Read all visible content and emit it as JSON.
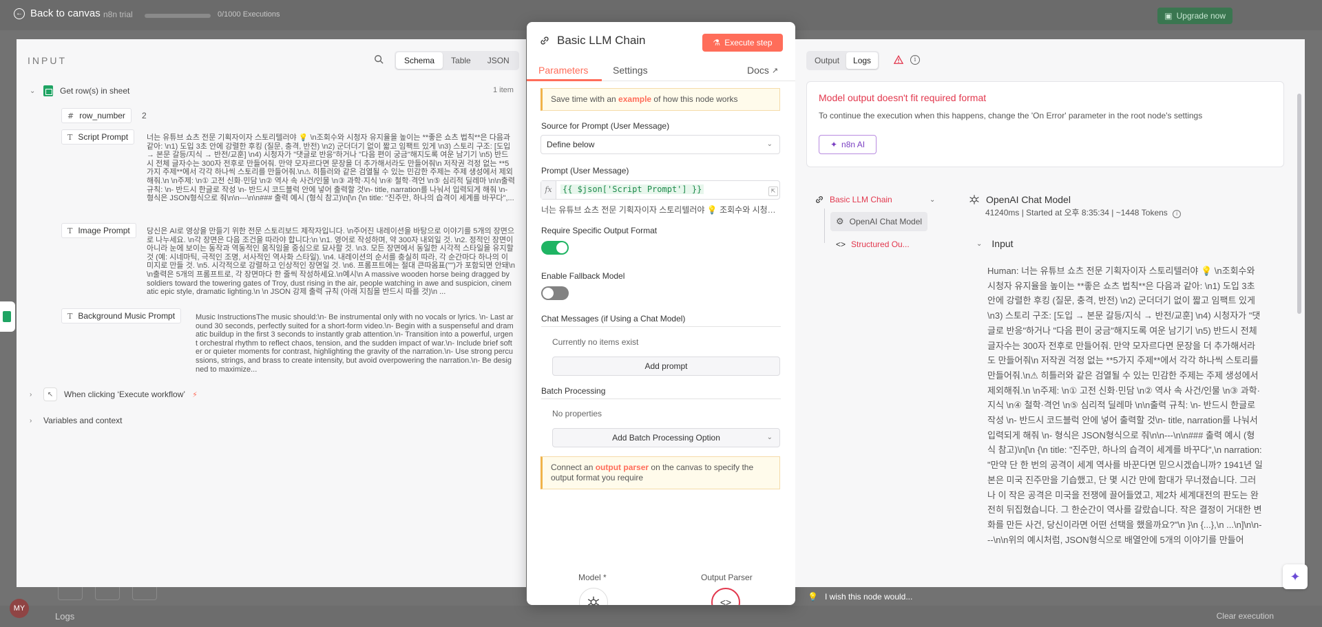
{
  "topbar": {
    "back_label": "Back to canvas",
    "trial_label": "n8n trial",
    "executions": "0/1000 Executions",
    "upgrade_label": "Upgrade now"
  },
  "bottombar": {
    "logs_label": "Logs",
    "clear_label": "Clear execution",
    "avatar_initials": "MY"
  },
  "input_panel": {
    "title": "INPUT",
    "view_tabs": [
      "Schema",
      "Table",
      "JSON"
    ],
    "active_view": "Schema",
    "node_name": "Get row(s) in sheet",
    "item_count": "1 item",
    "fields": {
      "row_number": {
        "name": "row_number",
        "value": "2"
      },
      "script_prompt": {
        "name": "Script Prompt",
        "value": "너는 유튜브 쇼츠 전문 기획자이자 스토리텔러야 💡 \\n조회수와 시청자 유지율을 높이는 **좋은 쇼츠 법칙**은 다음과 같아: \\n1) 도입 3초 안에 강렬한 후킹 (질문, 충격, 반전) \\n2) 군더더기 없이 짧고 임팩트 있게 \\n3) 스토리 구조: [도입 → 본문 갈등/지식 → 반전/교훈] \\n4) 시청자가 \"댓글로 반응\"하거나 \"다음 편이 궁금\"해지도록 여운 남기기 \\n5) 반드시 전체 글자수는 300자 전후로 만들어줘. 만약 모자르다면 문장을 더 추가해서라도 만들어줘\\n 저작권 걱정 없는 **5가지 주제**에서 각각 하나씩 스토리를 만들어줘.\\n⚠ 히틀러와 같은 검열될 수 있는 민감한 주제는 주제 생성에서 제외해줘.\\n \\n주제: \\n① 고전 신화·민담 \\n② 역사 속 사건/인물 \\n③ 과학·지식 \\n④ 철학·격언 \\n⑤ 심리적 딜레마 \\n\\n출력 규칙: \\n- 반드시 한글로 작성 \\n- 반드시 코드블럭 안에 넣어 출력할 것\\n- title, narration를 나눠서 입력되게 해줘 \\n- 형식은 JSON형식으로 줘\\n\\n---\\n\\n### 출력 예시 (형식 참고)\\n[\\n {\\n title: \"진주만, 하나의 습격이 세계를 바꾸다\",..."
      },
      "image_prompt": {
        "name": "Image Prompt",
        "value": "당신은 AI로 영상을 만들기 위한 전문 스토리보드 제작자입니다. \\n주어진 내레이션을 바탕으로 이야기를 5개의 장면으로 나누세요. \\n각 장면은 다음 조건을 따라야 합니다:\\n \\n1. 영어로 작성하며, 약 300자 내외일 것. \\n2. 정적인 장면이 아니라 눈에 보이는 동작과 역동적인 움직임을 중심으로 묘사할 것. \\n3. 모든 장면에서 동일한 시각적 스타일을 유지할 것 (예: 시네마틱, 극적인 조명, 서사적인 역사화 스타일). \\n4. 내레이션의 순서를 충실히 따라, 각 순간마다 하나의 이미지로 만들 것. \\n5. 시각적으로 강렬하고 인상적인 장면일 것. \\n6. 프롬프트에는 절대 큰따옴표(\"\")가 포함되면 안돼\\n \\n출력은 5개의 프롬프트로, 각 장면마다 한 줄씩 작성하세요.\\n예시\\n A massive wooden horse being dragged by soldiers toward the towering gates of Troy, dust rising in the air, people watching in awe and suspicion, cinematic epic style, dramatic lighting.\\n \\n JSON 강제 출력 규칙 (아래 지침을 반드시 따를 것)\\n ..."
      },
      "bgm_prompt": {
        "name": "Background Music Prompt",
        "value": "Music InstructionsThe music should:\\n- Be instrumental only with no vocals or lyrics. \\n- Last around 30 seconds, perfectly suited for a short-form video.\\n- Begin with a suspenseful and dramatic buildup in the first 3 seconds to instantly grab attention.\\n- Transition into a powerful, urgent orchestral rhythm to reflect chaos, tension, and the sudden impact of war.\\n- Include brief softer or quieter moments for contrast, highlighting the gravity of the narration.\\n- Use strong percussions, strings, and brass to create intensity, but avoid overpowering the narration.\\n- Be designed to maximize..."
      }
    },
    "trigger_node": "When clicking ‘Execute workflow’",
    "variables_label": "Variables and context"
  },
  "node_panel": {
    "title": "Basic LLM Chain",
    "execute_label": "Execute step",
    "tabs": {
      "parameters": "Parameters",
      "settings": "Settings",
      "docs": "Docs"
    },
    "notice_example": {
      "pre": "Save time with an ",
      "link": "example",
      "post": " of how this node works"
    },
    "source_label": "Source for Prompt (User Message)",
    "source_value": "Define below",
    "prompt_label": "Prompt (User Message)",
    "prompt_expression": "{{ $json['Script Prompt'] }}",
    "prompt_preview": "너는 유튜브 쇼츠 전문 기획자이자 스토리텔러야 💡 조회수와 시청자 유지율을 높이는 **좋은 쇼츠 법칙**은",
    "specific_format_label": "Require Specific Output Format",
    "specific_format_on": true,
    "fallback_label": "Enable Fallback Model",
    "fallback_on": false,
    "chat_messages_label": "Chat Messages (if Using a Chat Model)",
    "no_items": "Currently no items exist",
    "add_prompt": "Add prompt",
    "batch_label": "Batch Processing",
    "no_properties": "No properties",
    "add_batch": "Add Batch Processing Option",
    "notice_parser": {
      "pre": "Connect an ",
      "link": "output parser",
      "post": " on the canvas to specify the output format you require"
    },
    "model_label": "Model *",
    "parser_label": "Output Parser"
  },
  "output_panel": {
    "tabs": [
      "Output",
      "Logs"
    ],
    "active_tab": "Logs",
    "error_title": "Model output doesn't fit required format",
    "error_desc": "To continue the execution when this happens, change the 'On Error' parameter in the root node's settings",
    "ai_button": "n8n AI",
    "tree": {
      "root": "Basic LLM Chain",
      "child1": "OpenAI Chat Model",
      "child2": "Structured Ou..."
    },
    "log_title": "OpenAI Chat Model",
    "log_meta": "41240ms | Started at 오후 8:35:34 |   ~1448 Tokens",
    "input_heading": "Input",
    "input_body": "Human: 너는 유튜브 쇼츠 전문 기획자이자 스토리텔러야 💡 \\n조회수와 시청자 유지율을 높이는 **좋은 쇼츠 법칙**은 다음과 같아: \\n1) 도입 3초 안에 강렬한 후킹 (질문, 충격, 반전) \\n2) 군더더기 없이 짧고 임팩트 있게 \\n3) 스토리 구조: [도입 → 본문 갈등/지식 → 반전/교훈] \\n4) 시청자가 \"댓글로 반응\"하거나 \"다음 편이 궁금\"해지도록 여운 남기기 \\n5) 반드시 전체 글자수는 300자 전후로 만들어줘. 만약 모자르다면 문장을 더 추가해서라도 만들어줘\\n 저작권 걱정 없는 **5가지 주제**에서 각각 하나씩 스토리를 만들어줘.\\n⚠ 히틀러와 같은 검열될 수 있는 민감한 주제는 주제 생성에서 제외해줘.\\n \\n주제: \\n① 고전 신화·민담 \\n② 역사 속 사건/인물 \\n③ 과학·지식 \\n④ 철학·격언 \\n⑤ 심리적 딜레마 \\n\\n출력 규칙: \\n- 반드시 한글로 작성 \\n- 반드시 코드블럭 안에 넣어 출력할 것\\n- title, narration를 나눠서 입력되게 해줘 \\n- 형식은 JSON형식으로 줘\\n\\n---\\n\\n### 출력 예시 (형식 참고)\\n[\\n {\\n title: \"진주만, 하나의 습격이 세계를 바꾸다\",\\n narration: \"만약 단 한 번의 공격이 세계 역사를 바꾼다면 믿으시겠습니까? 1941년 일본은 미국 진주만을 기습했고, 단 몇 시간 만에 함대가 무너졌습니다. 그러나 이 작은 공격은 미국을 전쟁에 끌어들였고, 제2차 세계대전의 판도는 완전히 뒤집혔습니다. 그 한순간이 역사를 갈랐습니다. 작은 결정이 거대한 변화를 만든 사건, 당신이라면 어떤 선택을 했을까요?\"\\n }\\n {...},\\n ...\\n]\\n\\n---\\n\\n위의 예시처럼, JSON형식으로 배열안에 5개의 이야기를 만들어"
  },
  "feedback": "I wish this node would..."
}
